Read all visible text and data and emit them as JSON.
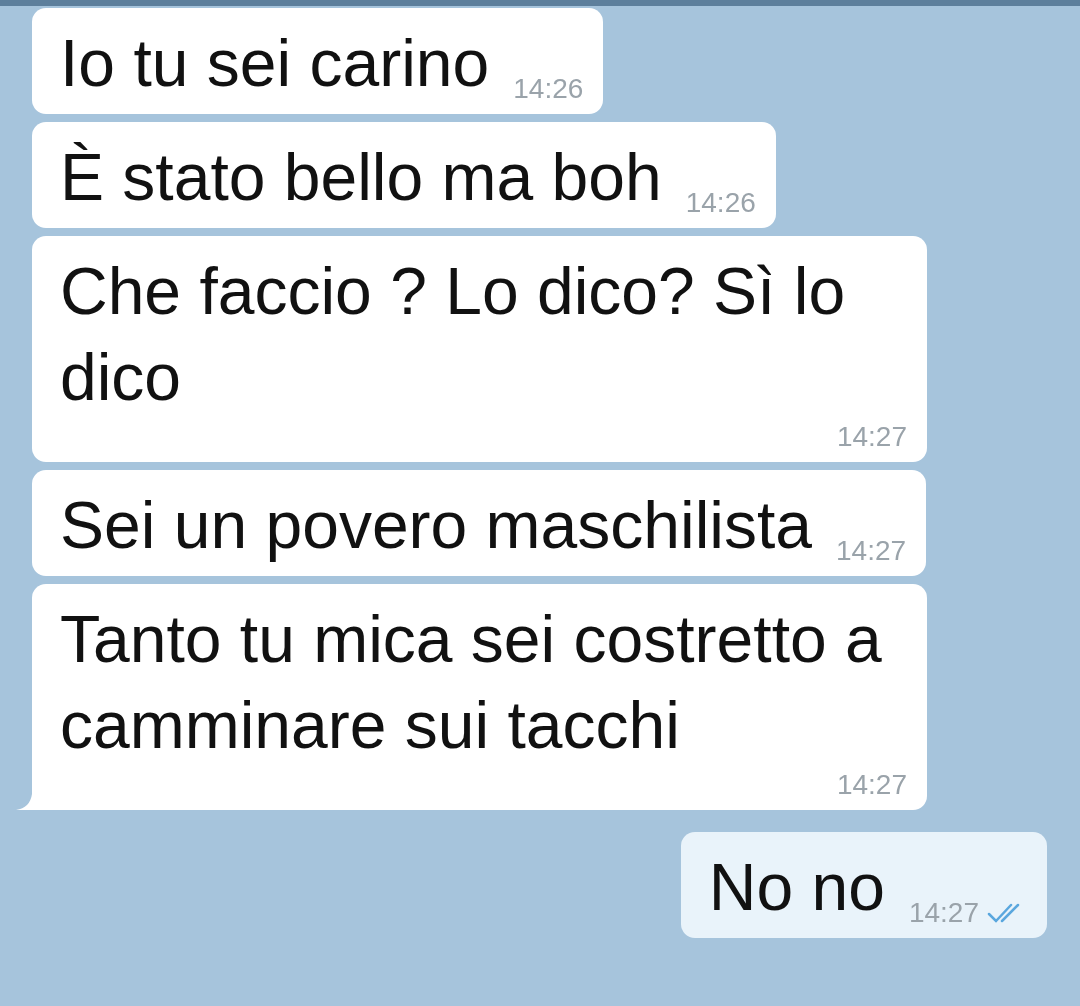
{
  "messages": [
    {
      "kind": "incoming",
      "text": "Io tu sei carino",
      "time": "14:26",
      "tail": false
    },
    {
      "kind": "incoming",
      "text": "È stato bello ma boh",
      "time": "14:26",
      "tail": false
    },
    {
      "kind": "incoming",
      "text": "Che faccio ? Lo dico? Sì lo dico",
      "time": "14:27",
      "tail": false
    },
    {
      "kind": "incoming",
      "text": "Sei un povero maschilista",
      "time": "14:27",
      "tail": false
    },
    {
      "kind": "incoming",
      "text": "Tanto tu mica sei costretto a camminare sui tacchi",
      "time": "14:27",
      "tail": true
    },
    {
      "kind": "outgoing",
      "text": "No no",
      "time": "14:27",
      "tail": false,
      "read": true
    }
  ]
}
